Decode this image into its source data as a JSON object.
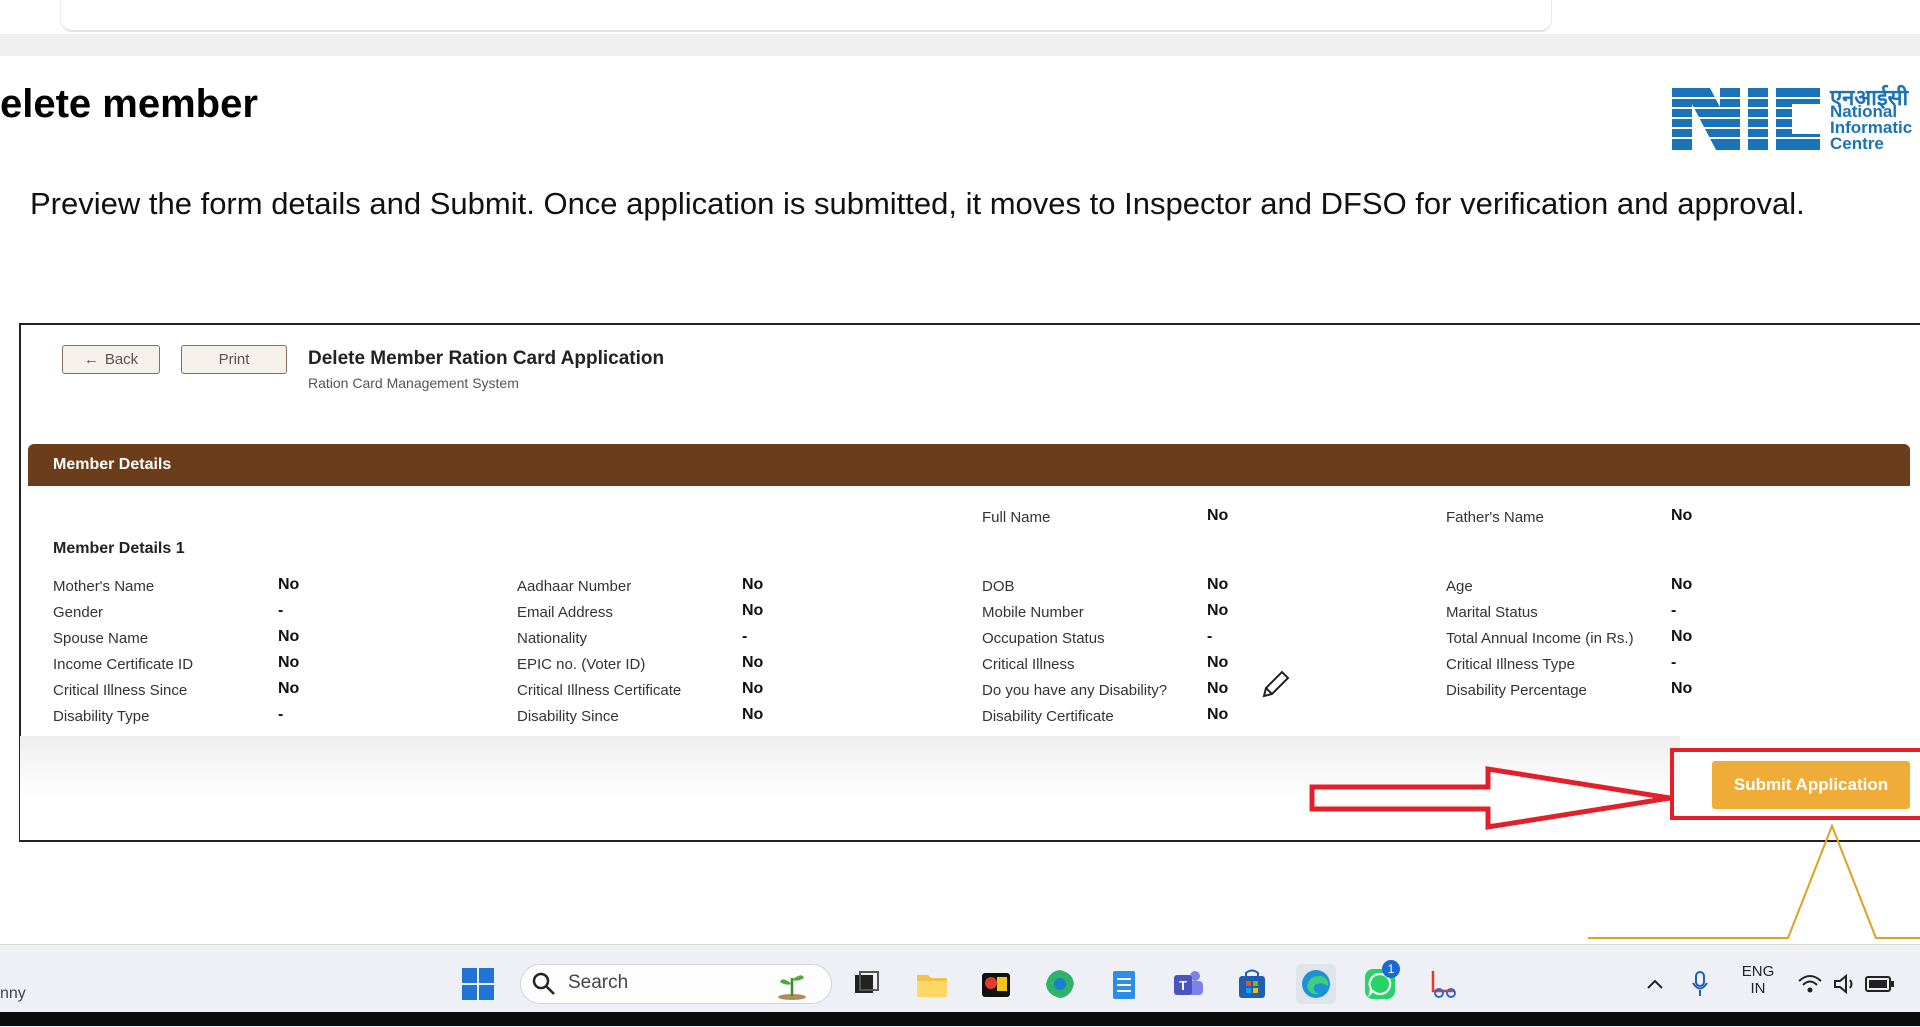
{
  "slide": {
    "title": "elete member",
    "intro": "Preview the form details and Submit. Once application is submitted, it moves to Inspector and DFSO for verification and approval.",
    "logo": {
      "hindi": "एनआईसी",
      "line1": "National",
      "line2": "Informatic",
      "line3": "Centre",
      "letters": "NIC",
      "color": "#1a73b8"
    }
  },
  "app": {
    "back_label": "Back",
    "print_label": "Print",
    "title": "Delete Member Ration Card Application",
    "subtitle": "Ration Card Management System",
    "section_title": "Member Details",
    "member_subtitle": "Member Details 1",
    "accent": "#6b3d1a",
    "fields": {
      "full_name": {
        "label": "Full Name",
        "value": "No"
      },
      "fathers_name": {
        "label": "Father's Name",
        "value": "No"
      },
      "mothers_name": {
        "label": "Mother's Name",
        "value": "No"
      },
      "aadhaar": {
        "label": "Aadhaar Number",
        "value": "No"
      },
      "dob": {
        "label": "DOB",
        "value": "No"
      },
      "age": {
        "label": "Age",
        "value": "No"
      },
      "gender": {
        "label": "Gender",
        "value": "-"
      },
      "email": {
        "label": "Email Address",
        "value": "No"
      },
      "mobile": {
        "label": "Mobile Number",
        "value": "No"
      },
      "marital": {
        "label": "Marital Status",
        "value": "-"
      },
      "spouse": {
        "label": "Spouse Name",
        "value": "No"
      },
      "nationality": {
        "label": "Nationality",
        "value": "-"
      },
      "occupation": {
        "label": "Occupation Status",
        "value": "-"
      },
      "income": {
        "label": "Total Annual Income (in Rs.)",
        "value": "No"
      },
      "income_cert": {
        "label": "Income Certificate ID",
        "value": "No"
      },
      "epic": {
        "label": "EPIC no. (Voter ID)",
        "value": "No"
      },
      "critical": {
        "label": "Critical Illness",
        "value": "No"
      },
      "critical_type": {
        "label": "Critical Illness Type",
        "value": "-"
      },
      "critical_since": {
        "label": "Critical Illness Since",
        "value": "No"
      },
      "critical_cert": {
        "label": "Critical Illness Certificate",
        "value": "No"
      },
      "disability_q": {
        "label": "Do you have any Disability?",
        "value": "No"
      },
      "disability_pct": {
        "label": "Disability Percentage",
        "value": "No"
      },
      "disability_type": {
        "label": "Disability Type",
        "value": "-"
      },
      "disability_since": {
        "label": "Disability Since",
        "value": "No"
      },
      "disability_cert": {
        "label": "Disability Certificate",
        "value": "No"
      }
    },
    "submit_label": "Submit Application",
    "submit_color": "#f0ac38",
    "highlight_color": "#e3202a"
  },
  "taskbar": {
    "weather_fragment": "nny",
    "search_placeholder": "Search",
    "whatsapp_badge": "1",
    "lang_line1": "ENG",
    "lang_line2": "IN"
  }
}
